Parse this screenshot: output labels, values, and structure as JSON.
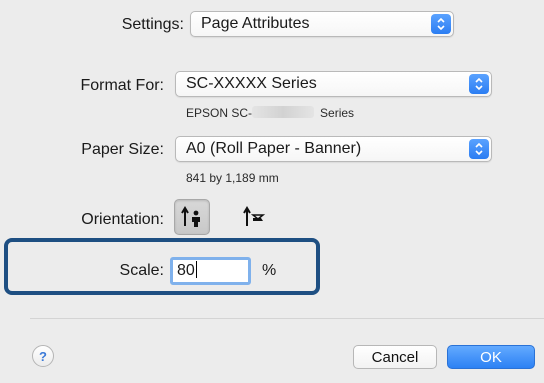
{
  "settings": {
    "label": "Settings:",
    "value": "Page Attributes"
  },
  "format_for": {
    "label": "Format For:",
    "value": "SC-XXXXX Series",
    "subtext_left": "EPSON SC-",
    "subtext_right": "Series"
  },
  "paper_size": {
    "label": "Paper Size:",
    "value": "A0 (Roll Paper - Banner)",
    "subtext": "841 by 1,189 mm"
  },
  "orientation": {
    "label": "Orientation:"
  },
  "scale": {
    "label": "Scale:",
    "value": "80",
    "unit": "%"
  },
  "footer": {
    "help": "?",
    "cancel": "Cancel",
    "ok": "OK"
  },
  "colors": {
    "accent": "#2c81f4",
    "highlight_box": "#1e4f82",
    "focus_ring": "#7fb1ec"
  }
}
